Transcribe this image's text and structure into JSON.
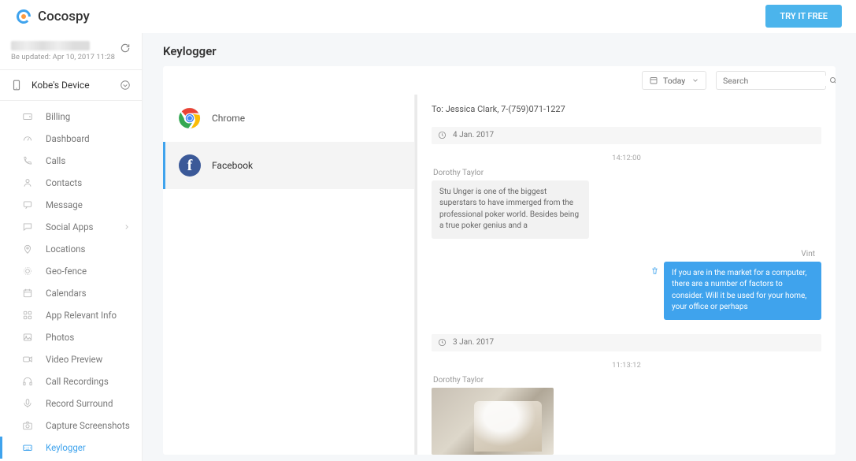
{
  "brand": {
    "name": "Cocospy",
    "cta": "TRY IT FREE"
  },
  "account": {
    "updated_line": "Be updated: Apr 10, 2017 11:28"
  },
  "device": {
    "label": "Kobe's Device"
  },
  "nav": {
    "billing": "Billing",
    "dashboard": "Dashboard",
    "calls": "Calls",
    "contacts": "Contacts",
    "message": "Message",
    "social": "Social Apps",
    "locations": "Locations",
    "geofence": "Geo-fence",
    "calendars": "Calendars",
    "appinfo": "App Relevant Info",
    "photos": "Photos",
    "video": "Video Preview",
    "callrec": "Call Recordings",
    "recsurr": "Record Surround",
    "capture": "Capture Screenshots",
    "keylogger": "Keylogger"
  },
  "page_title": "Keylogger",
  "toolbar": {
    "range": "Today",
    "search_placeholder": "Search"
  },
  "apps": {
    "chrome": "Chrome",
    "facebook": "Facebook"
  },
  "conversation": {
    "to_line": "To: Jessica Clark, 7-(759)071-1227",
    "groups": [
      {
        "date": "4 Jan. 2017",
        "time": "14:12:00",
        "in": {
          "sender": "Dorothy Taylor",
          "text": "Stu Unger is one of the biggest superstars to have immerged from the professional poker world. Besides being a true poker genius and a"
        },
        "out": {
          "sender": "Vint",
          "text": "If you are in the market for a computer, there are a number of factors to consider. Will it be used for your home, your office or perhaps"
        }
      },
      {
        "date": "3 Jan. 2017",
        "time": "11:13:12",
        "in": {
          "sender": "Dorothy Taylor"
        }
      }
    ]
  }
}
